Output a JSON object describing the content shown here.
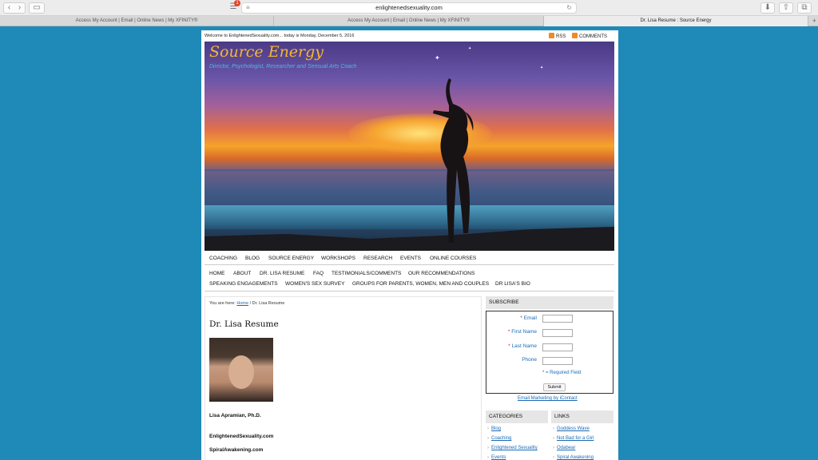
{
  "browser": {
    "url": "enlightenedsexuality.com",
    "extension_badge": "1",
    "tabs": [
      {
        "label": "Access My Account | Email | Online News | My XFINITY®"
      },
      {
        "label": "Access My Account | Email | Online News | My XFINITY®"
      },
      {
        "label": "Dr. Lisa Resume : Source Energy"
      }
    ],
    "new_tab_label": "+"
  },
  "topbar": {
    "welcome": "Welcome to EnlightenedSexuality.com... today is Monday, December 5, 2016",
    "rss_label": "RSS",
    "comments_label": "COMMENTS"
  },
  "header": {
    "title": "Source Energy",
    "tagline": "Director, Psychologist, Researcher and Sensual Arts Coach"
  },
  "nav_primary": [
    "COACHING",
    "BLOG",
    "SOURCE ENERGY",
    "WORKSHOPS",
    "RESEARCH",
    "EVENTS",
    "ONLINE COURSES"
  ],
  "nav_secondary": {
    "row1": [
      "HOME",
      "ABOUT",
      "DR. LISA RESUME",
      "FAQ",
      "TESTIMONIALS/COMMENTS",
      "OUR RECOMMENDATIONS"
    ],
    "row2": [
      "SPEAKING ENGAGEMENTS",
      "WOMEN'S SEX SURVEY",
      "GROUPS FOR PARENTS, WOMEN, MEN AND COUPLES",
      "DR LISA'S BIO"
    ]
  },
  "content": {
    "breadcrumb_prefix": "You are here:",
    "breadcrumb_home": "Home",
    "breadcrumb_sep": "/",
    "breadcrumb_current": "Dr. Lisa Resume",
    "title": "Dr. Lisa Resume",
    "lines": [
      "Lisa Apramian, Ph.D.",
      "EnlightenedSexuality.com",
      "SpiralAwakening.com"
    ]
  },
  "subscribe": {
    "heading": "SUBSCRIBE",
    "fields": [
      "Email",
      "First Name",
      "Last Name",
      "Phone"
    ],
    "required_marker": "*",
    "required_note": "= Required Field",
    "submit_label": "Submit",
    "email_marketing": "Email Marketing by iContact"
  },
  "categories": {
    "heading": "CATEGORIES",
    "items": [
      "Blog",
      "Coaching",
      "Enlightened Sexuality",
      "Events"
    ]
  },
  "links": {
    "heading": "LINKS",
    "items": [
      "Goddess Wave",
      "Not Bad for a Girl",
      "Odabear",
      "Spiral Awakening"
    ]
  },
  "colors": {
    "page_background": "#1f8ab8",
    "link": "#1a6bb5",
    "title_gold": "#f5b731",
    "tagline_blue": "#4fb7e8",
    "feed_orange": "#f08a24"
  }
}
